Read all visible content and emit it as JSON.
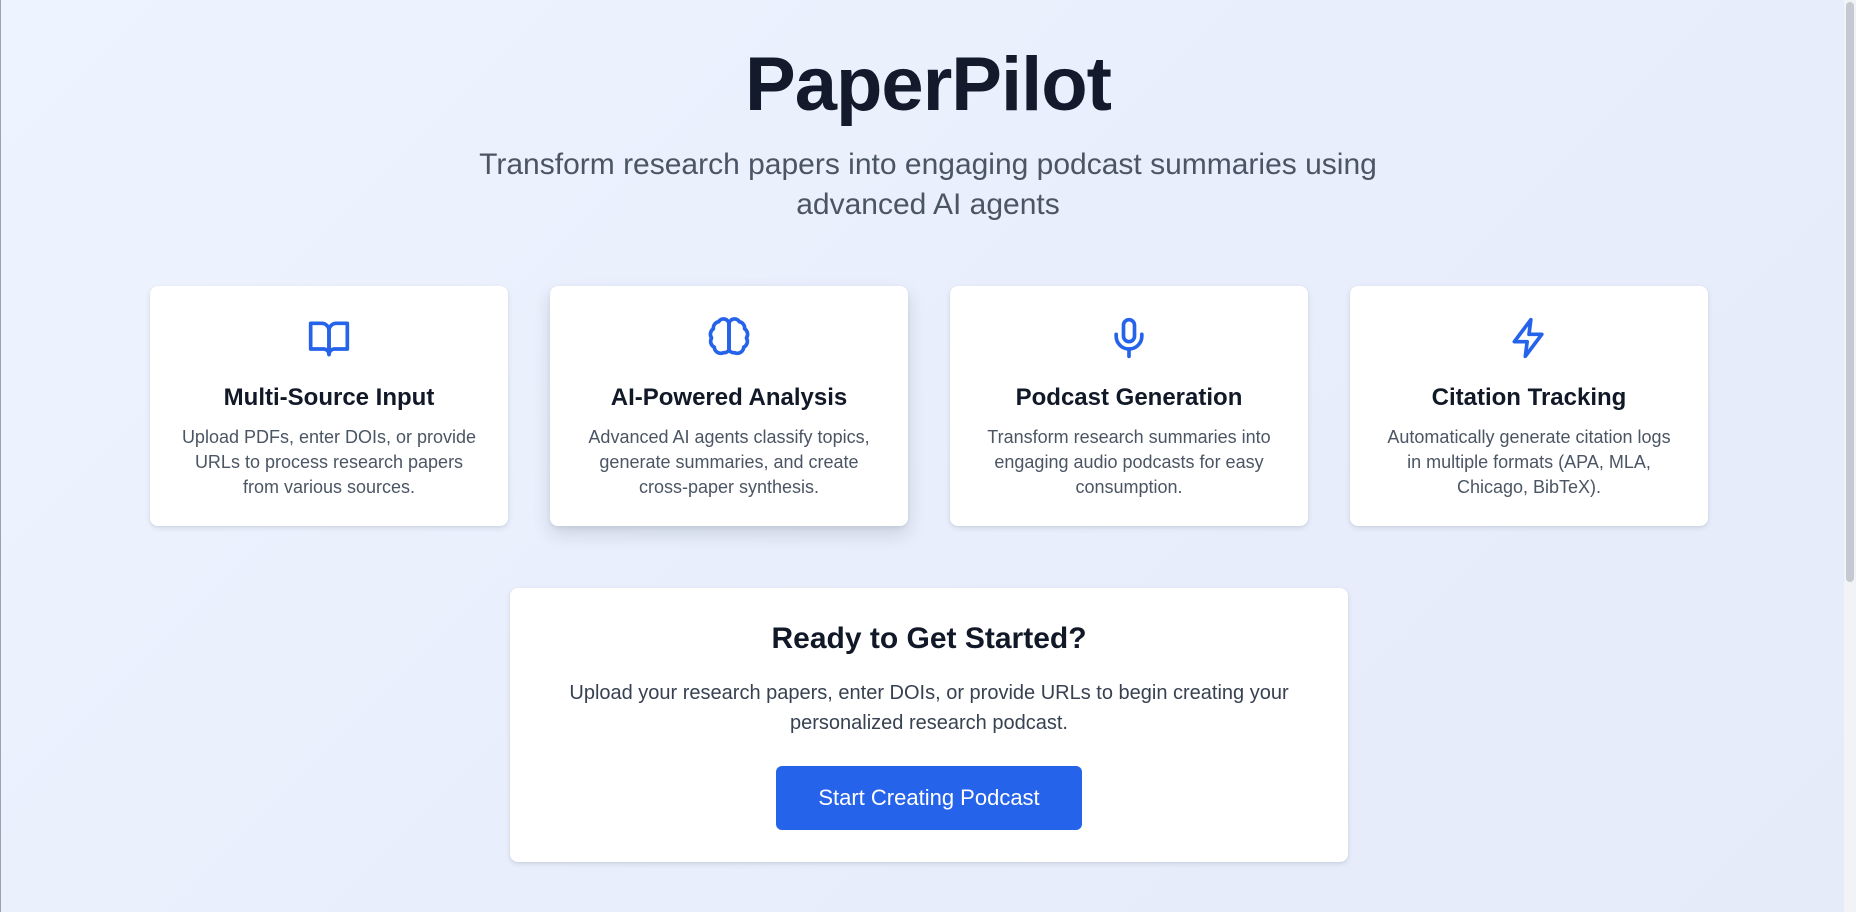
{
  "header": {
    "title": "PaperPilot",
    "subtitle": "Transform research papers into engaging podcast summaries using advanced AI agents"
  },
  "features": [
    {
      "icon": "book-open-icon",
      "title": "Multi-Source Input",
      "description": "Upload PDFs, enter DOIs, or provide URLs to process research papers from various sources."
    },
    {
      "icon": "brain-icon",
      "title": "AI-Powered Analysis",
      "description": "Advanced AI agents classify topics, generate summaries, and create cross-paper synthesis."
    },
    {
      "icon": "microphone-icon",
      "title": "Podcast Generation",
      "description": "Transform research summaries into engaging audio podcasts for easy consumption."
    },
    {
      "icon": "lightning-icon",
      "title": "Citation Tracking",
      "description": "Automatically generate citation logs in multiple formats (APA, MLA, Chicago, BibTeX)."
    }
  ],
  "cta": {
    "title": "Ready to Get Started?",
    "description": "Upload your research papers, enter DOIs, or provide URLs to begin creating your personalized research podcast.",
    "button_label": "Start Creating Podcast"
  },
  "colors": {
    "accent": "#2563eb",
    "heading": "#111827",
    "body_text": "#4b5563"
  }
}
